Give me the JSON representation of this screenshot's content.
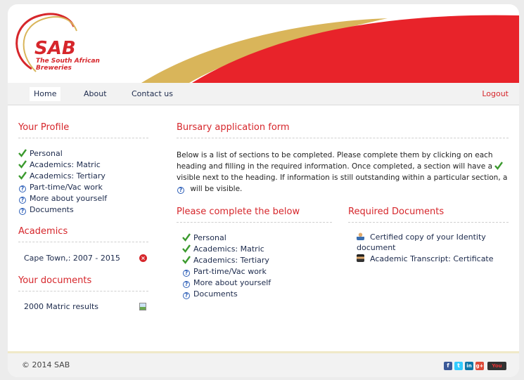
{
  "brand": {
    "logo_text": "SAB",
    "logo_sub_line1": "The South African",
    "logo_sub_line2": "Breweries",
    "colors": {
      "red": "#d6262b",
      "gold": "#d9b55a",
      "navy": "#1c2a4c"
    }
  },
  "nav": {
    "items": [
      {
        "label": "Home",
        "active": true
      },
      {
        "label": "About"
      },
      {
        "label": "Contact us"
      }
    ],
    "logout_label": "Logout"
  },
  "sidebar": {
    "profile_title": "Your Profile",
    "profile_items": [
      {
        "label": "Personal",
        "status": "check-icon"
      },
      {
        "label": "Academics: Matric",
        "status": "check-icon"
      },
      {
        "label": "Academics: Tertiary",
        "status": "check-icon"
      },
      {
        "label": "Part-time/Vac work",
        "status": "question-icon"
      },
      {
        "label": "More about yourself",
        "status": "question-icon"
      },
      {
        "label": "Documents",
        "status": "question-icon"
      }
    ],
    "academics_title": "Academics",
    "academics_entry": "Cape Town,: 2007 - 2015",
    "documents_title": "Your documents",
    "document_entry": "2000 Matric results"
  },
  "main": {
    "form_title": "Bursary application form",
    "intro_part1": "Below is a list of sections to be completed. Please complete them by clicking on each heading and filling in the required information. Once completed, a section will have a",
    "intro_part2": "visible next to the heading. If information is still outstanding within a particular section, a",
    "intro_part3": "will be visible.",
    "complete_title": "Please complete the below",
    "complete_items": [
      {
        "label": "Personal",
        "status": "check-icon"
      },
      {
        "label": "Academics: Matric",
        "status": "check-icon"
      },
      {
        "label": "Academics: Tertiary",
        "status": "check-icon"
      },
      {
        "label": "Part-time/Vac work",
        "status": "question-icon"
      },
      {
        "label": "More about yourself",
        "status": "question-icon"
      },
      {
        "label": "Documents",
        "status": "question-icon"
      }
    ],
    "required_title": "Required Documents",
    "required_items": [
      {
        "label": "Certified copy of your Identity document",
        "icon": "person-icon"
      },
      {
        "label": "Academic Transcript: Certificate",
        "icon": "graduate-icon"
      }
    ]
  },
  "footer": {
    "copyright": "© 2014 SAB",
    "social_icons": [
      "facebook-icon",
      "twitter-icon",
      "linkedin-icon",
      "googleplus-icon",
      "youtube-icon"
    ],
    "social_glyphs": [
      "f",
      "t",
      "in",
      "g+",
      "You"
    ]
  }
}
